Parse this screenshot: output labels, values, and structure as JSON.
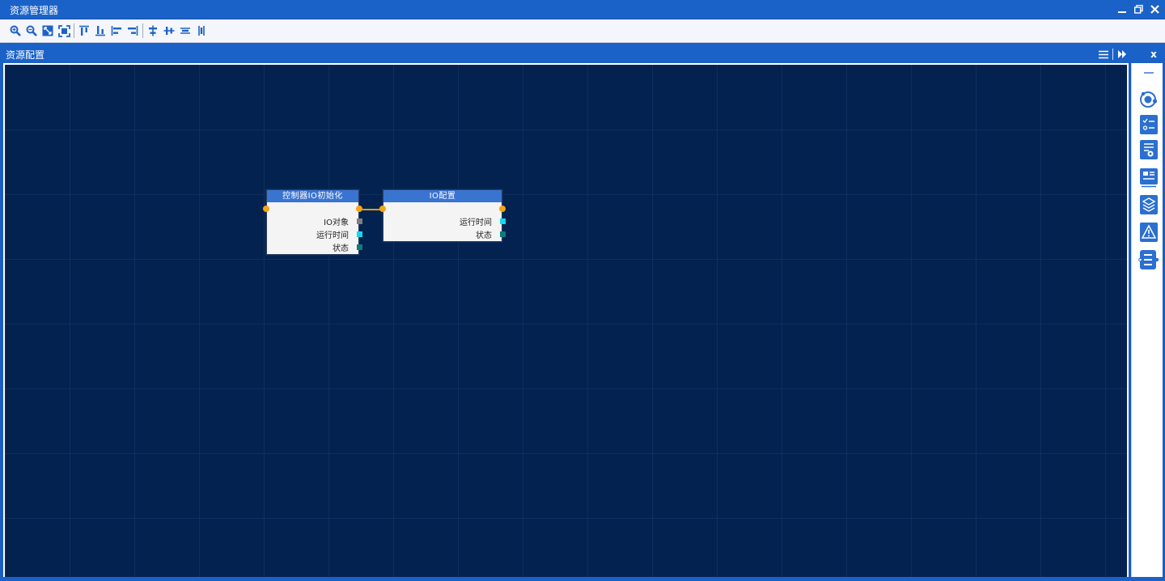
{
  "window": {
    "title": "资源管理器",
    "minimize_icon": "minimize-icon",
    "restore_icon": "restore-icon",
    "close_icon": "close-icon"
  },
  "toolbar": {
    "tools": [
      "zoom-in-icon",
      "zoom-out-icon",
      "fit-view-icon",
      "fit-selection-icon",
      "align-top-icon",
      "align-bottom-icon",
      "align-left-icon",
      "align-right-icon",
      "center-vertical-icon",
      "center-horizontal-icon",
      "distribute-vertical-icon",
      "distribute-horizontal-icon"
    ]
  },
  "panel": {
    "title": "资源配置",
    "menu_icon": "menu-icon",
    "expand_icon": "fast-forward-icon",
    "close_label": "x"
  },
  "graph": {
    "nodes": [
      {
        "title": "控制器IO初始化",
        "ports": [
          {
            "label": "IO对象",
            "color": "#7f7f7f"
          },
          {
            "label": "运行时间",
            "color": "#16d7ef"
          },
          {
            "label": "状态",
            "color": "#0f7b7b"
          }
        ]
      },
      {
        "title": "IO配置",
        "ports": [
          {
            "label": "运行时间",
            "color": "#16d7ef"
          },
          {
            "label": "状态",
            "color": "#0f7b7b"
          }
        ]
      }
    ],
    "connection_color": "#e39c10"
  },
  "right_sidebar": {
    "items": [
      "collapse-icon",
      "orbit-icon",
      "checklist-icon",
      "list-settings-icon",
      "dashboard-icon",
      "layers-icon",
      "warning-icon",
      "list-connector-icon"
    ]
  },
  "colors": {
    "accent": "#1b62c8",
    "canvas": "#04224f",
    "node_header": "#3a74d1",
    "connector": "#f3a512"
  }
}
